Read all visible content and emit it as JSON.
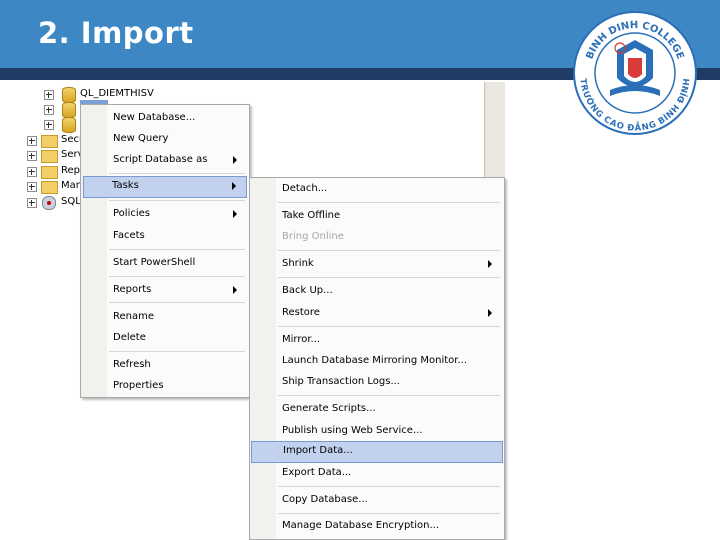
{
  "slide": {
    "title": "2. Import"
  },
  "logo": {
    "text_top": "BINH DINH COLLEGE",
    "text_bottom": "TRƯỜNG CAO ĐẲNG BÌNH ĐỊNH"
  },
  "tree": {
    "items": [
      {
        "label": "QL_DIEMTHISV",
        "icon": "database-icon"
      },
      {
        "label": "",
        "icon": "database-icon"
      },
      {
        "label": "",
        "icon": "database-icon"
      },
      {
        "label": "Secu",
        "icon": "folder-icon"
      },
      {
        "label": "Serv",
        "icon": "folder-icon"
      },
      {
        "label": "Rep",
        "icon": "folder-icon"
      },
      {
        "label": "Man",
        "icon": "folder-icon"
      },
      {
        "label": "SQL",
        "icon": "sql-agent-icon"
      }
    ]
  },
  "context_menu": {
    "items": [
      {
        "label": "New Database...",
        "submenu": false
      },
      {
        "label": "New Query",
        "submenu": false
      },
      {
        "label": "Script Database as",
        "submenu": true
      },
      {
        "label": "Tasks",
        "submenu": true,
        "highlighted": true
      },
      {
        "label": "Policies",
        "submenu": true
      },
      {
        "label": "Facets",
        "submenu": false
      },
      {
        "label": "Start PowerShell",
        "submenu": false
      },
      {
        "label": "Reports",
        "submenu": true
      },
      {
        "label": "Rename",
        "submenu": false
      },
      {
        "label": "Delete",
        "submenu": false
      },
      {
        "label": "Refresh",
        "submenu": false
      },
      {
        "label": "Properties",
        "submenu": false
      }
    ]
  },
  "tasks_menu": {
    "items": [
      {
        "label": "Detach...",
        "submenu": false
      },
      {
        "label": "Take Offline",
        "submenu": false
      },
      {
        "label": "Bring Online",
        "submenu": false,
        "disabled": true
      },
      {
        "label": "Shrink",
        "submenu": true
      },
      {
        "label": "Back Up...",
        "submenu": false
      },
      {
        "label": "Restore",
        "submenu": true
      },
      {
        "label": "Mirror...",
        "submenu": false
      },
      {
        "label": "Launch Database Mirroring Monitor...",
        "submenu": false
      },
      {
        "label": "Ship Transaction Logs...",
        "submenu": false
      },
      {
        "label": "Generate Scripts...",
        "submenu": false
      },
      {
        "label": "Publish using Web Service...",
        "submenu": false
      },
      {
        "label": "Import Data...",
        "submenu": false,
        "highlighted": true
      },
      {
        "label": "Export Data...",
        "submenu": false
      },
      {
        "label": "Copy Database...",
        "submenu": false
      },
      {
        "label": "Manage Database Encryption...",
        "submenu": false
      }
    ]
  },
  "colors": {
    "header": "#3c87c4",
    "header_stripe": "#1f3d64",
    "highlight": "#c2d2ee"
  }
}
